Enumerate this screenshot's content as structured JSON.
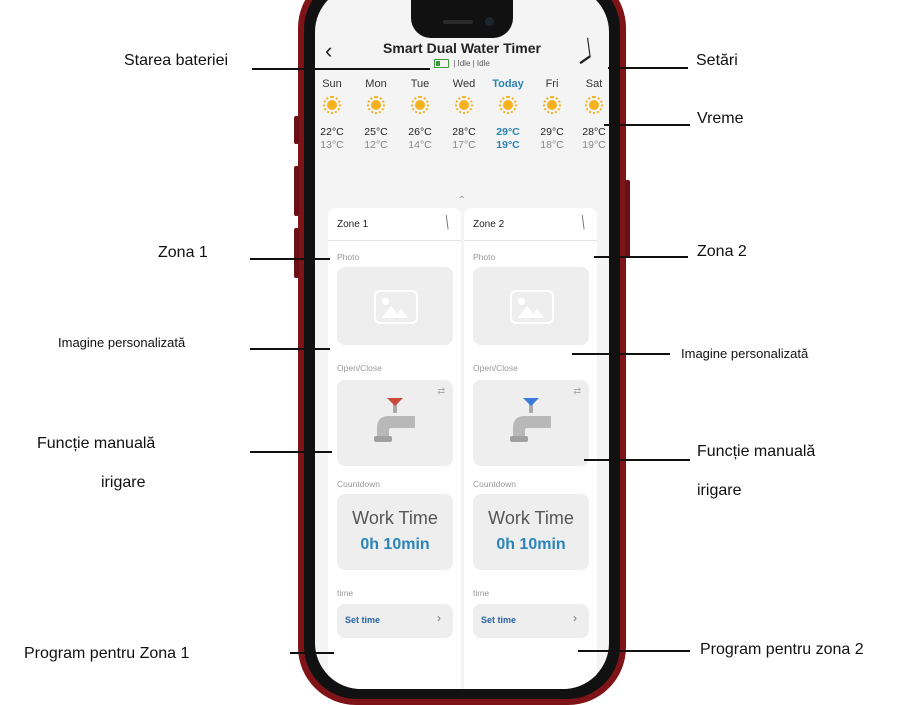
{
  "app": {
    "title": "Smart Dual Water Timer",
    "status": "| Idle | Idle",
    "back_icon": "back-chevron-icon",
    "edit_icon": "pencil-icon"
  },
  "weather": {
    "days": [
      {
        "name": "Sun",
        "hi": "22°C",
        "lo": "13°C"
      },
      {
        "name": "Mon",
        "hi": "25°C",
        "lo": "12°C"
      },
      {
        "name": "Tue",
        "hi": "26°C",
        "lo": "14°C"
      },
      {
        "name": "Wed",
        "hi": "28°C",
        "lo": "17°C"
      },
      {
        "name": "Today",
        "hi": "29°C",
        "lo": "19°C"
      },
      {
        "name": "Fri",
        "hi": "29°C",
        "lo": "18°C"
      },
      {
        "name": "Sat",
        "hi": "28°C",
        "lo": "19°C"
      }
    ],
    "icon": "sun-icon",
    "today_color": "#2a84b8"
  },
  "zones": [
    {
      "name": "Zone 1",
      "photo_label": "Photo",
      "open_close_label": "Open/Close",
      "countdown_label": "Countdown",
      "work_time_label": "Work Time",
      "duration": "0h 10min",
      "time_label": "time",
      "set_time": "Set time",
      "valve_color": "#c84a3a"
    },
    {
      "name": "Zone 2",
      "photo_label": "Photo",
      "open_close_label": "Open/Close",
      "countdown_label": "Countdown",
      "work_time_label": "Work Time",
      "duration": "0h 10min",
      "time_label": "time",
      "set_time": "Set time",
      "valve_color": "#3a7ad8"
    }
  ],
  "annotations": {
    "battery": "Starea bateriei",
    "settings": "Setări",
    "weather": "Vreme",
    "zone1": "Zona 1",
    "zone2": "Zona 2",
    "custom_image_left": "Imagine personalizată",
    "custom_image_right": "Imagine personalizată",
    "manual_left_1": "Funcție manuală",
    "manual_left_2": "irigare",
    "manual_right_1": "Funcție manuală",
    "manual_right_2": "irigare",
    "schedule_zone1": "Program pentru Zona 1",
    "schedule_zone2": "Program pentru zona 2"
  }
}
